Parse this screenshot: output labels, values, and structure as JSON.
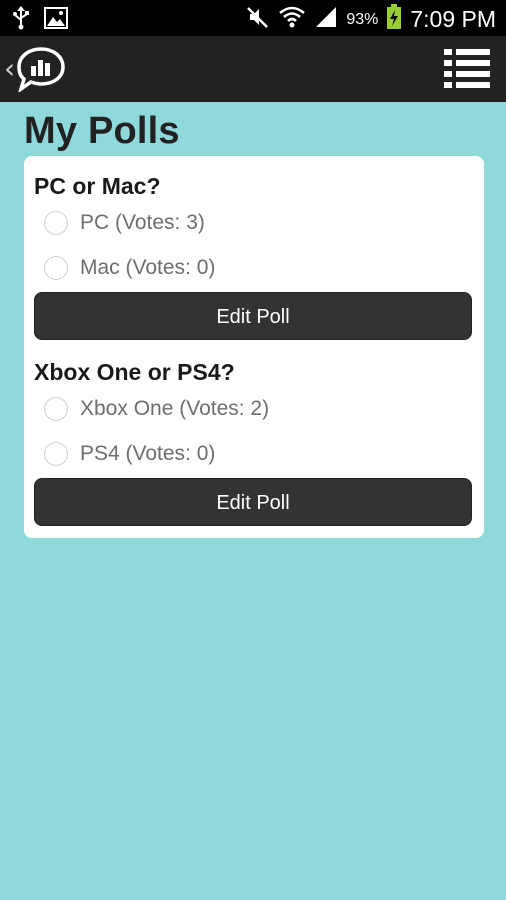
{
  "status_bar": {
    "battery_percent": "93%",
    "time": "7:09 PM",
    "icons": [
      "usb-icon",
      "image-notification-icon",
      "mute-icon",
      "wifi-icon",
      "signal-icon",
      "battery-charging-icon"
    ]
  },
  "action_bar": {
    "back_glyph": "‹",
    "app_icon": "poll-chat-bubble-icon",
    "menu_icon": "list-menu-icon"
  },
  "page": {
    "title": "My Polls"
  },
  "polls": [
    {
      "question": "PC or Mac?",
      "options": [
        {
          "label": "PC (Votes: 3)"
        },
        {
          "label": "Mac (Votes: 0)"
        }
      ],
      "button_label": "Edit Poll"
    },
    {
      "question": "Xbox One or PS4?",
      "options": [
        {
          "label": "Xbox One (Votes: 2)"
        },
        {
          "label": "PS4 (Votes: 0)"
        }
      ],
      "button_label": "Edit Poll"
    }
  ],
  "colors": {
    "background": "#8fd9db",
    "action_bar": "#222222",
    "button": "#333333",
    "card": "#ffffff"
  }
}
